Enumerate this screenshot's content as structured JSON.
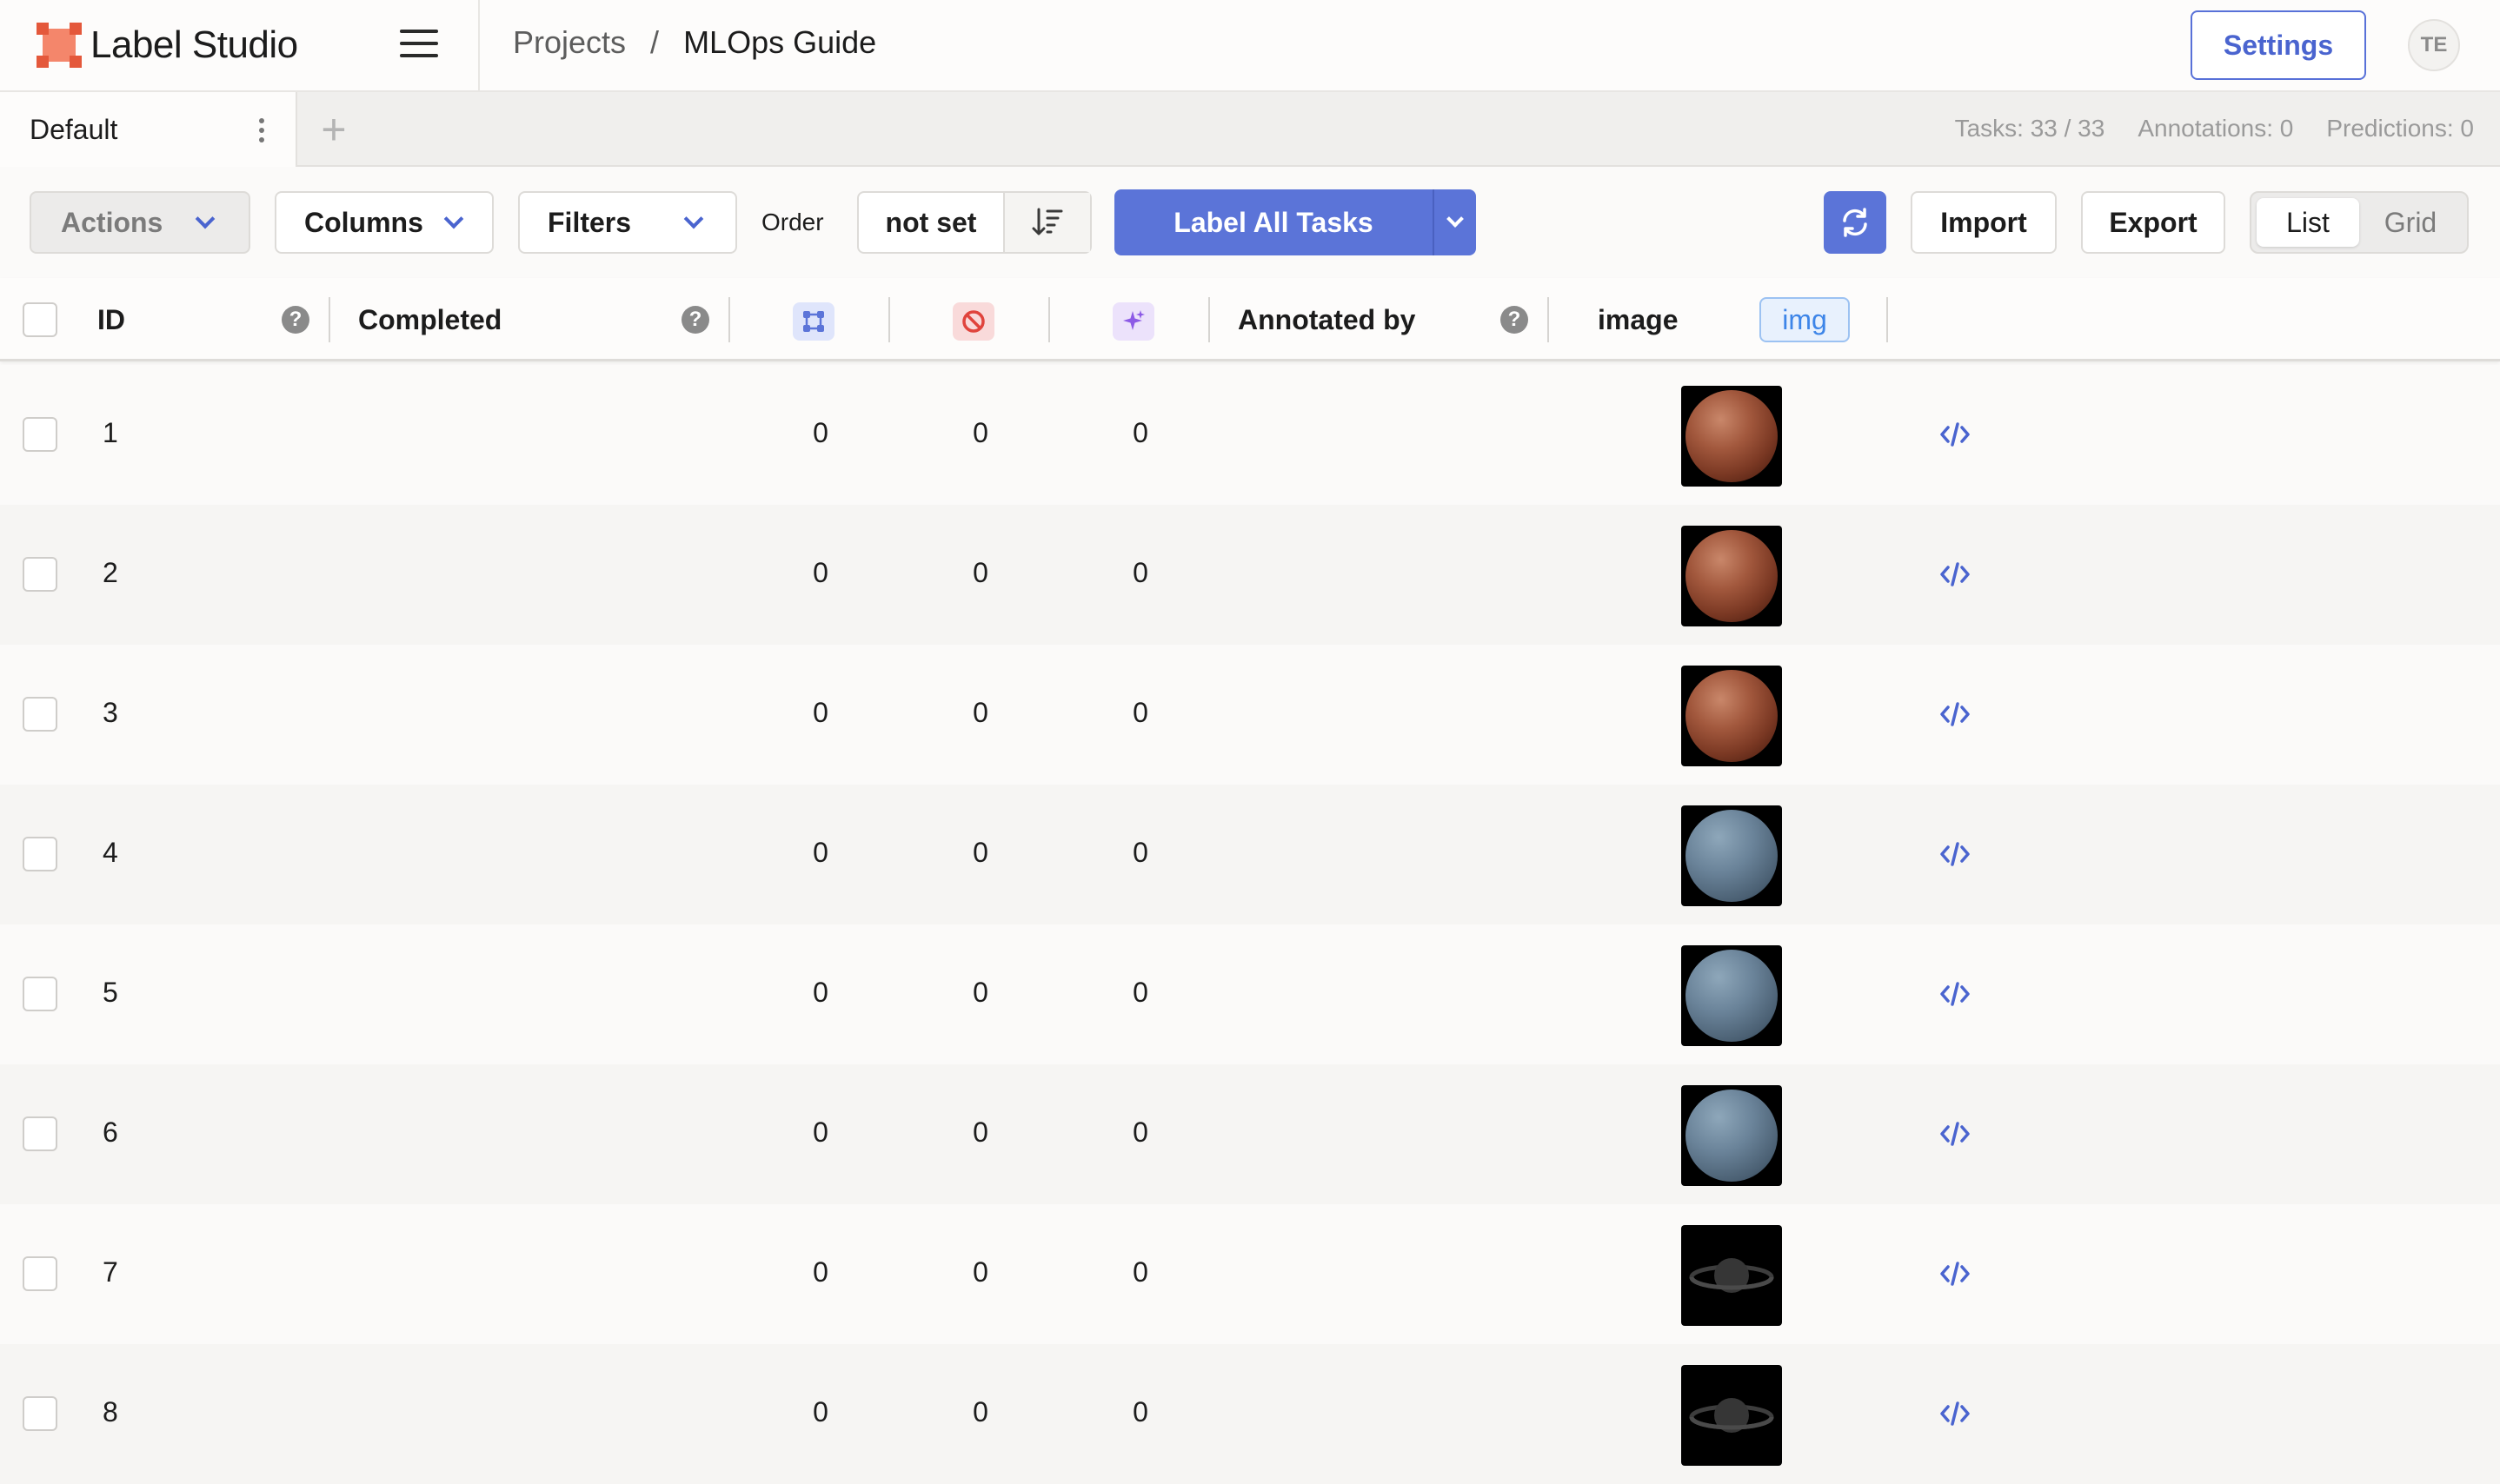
{
  "app": {
    "name": "Label Studio"
  },
  "nav": {
    "breadcrumb": [
      "Projects",
      "/",
      "MLOps Guide"
    ],
    "settings_label": "Settings",
    "avatar_initials": "TE"
  },
  "tabs": {
    "active_label": "Default",
    "add_symbol": "+"
  },
  "stats": {
    "tasks": "Tasks: 33 / 33",
    "annotations": "Annotations: 0",
    "predictions": "Predictions: 0"
  },
  "toolbar": {
    "actions_label": "Actions",
    "columns_label": "Columns",
    "filters_label": "Filters",
    "order_label": "Order",
    "order_value": "not set",
    "label_all_label": "Label All Tasks",
    "import_label": "Import",
    "export_label": "Export",
    "view_list": "List",
    "view_grid": "Grid",
    "active_view": "List"
  },
  "table": {
    "headers": {
      "id": "ID",
      "completed": "Completed",
      "annotated_by": "Annotated by",
      "image": "image",
      "image_type": "img"
    },
    "header_icons": [
      "total-annotations-icon",
      "cancelled-icon",
      "predictions-icon"
    ],
    "rows": [
      {
        "id": "1",
        "total": "0",
        "cancelled": "0",
        "predictions": "0",
        "planet": "mars"
      },
      {
        "id": "2",
        "total": "0",
        "cancelled": "0",
        "predictions": "0",
        "planet": "mars"
      },
      {
        "id": "3",
        "total": "0",
        "cancelled": "0",
        "predictions": "0",
        "planet": "mars"
      },
      {
        "id": "4",
        "total": "0",
        "cancelled": "0",
        "predictions": "0",
        "planet": "neptune"
      },
      {
        "id": "5",
        "total": "0",
        "cancelled": "0",
        "predictions": "0",
        "planet": "neptune"
      },
      {
        "id": "6",
        "total": "0",
        "cancelled": "0",
        "predictions": "0",
        "planet": "neptune"
      },
      {
        "id": "7",
        "total": "0",
        "cancelled": "0",
        "predictions": "0",
        "planet": "saturn"
      },
      {
        "id": "8",
        "total": "0",
        "cancelled": "0",
        "predictions": "0",
        "planet": "saturn"
      }
    ]
  },
  "colors": {
    "accent": "#5b74d8",
    "brand": "#e4583b",
    "row_even": "#f6f5f3",
    "row_odd": "#fbfaf9"
  }
}
